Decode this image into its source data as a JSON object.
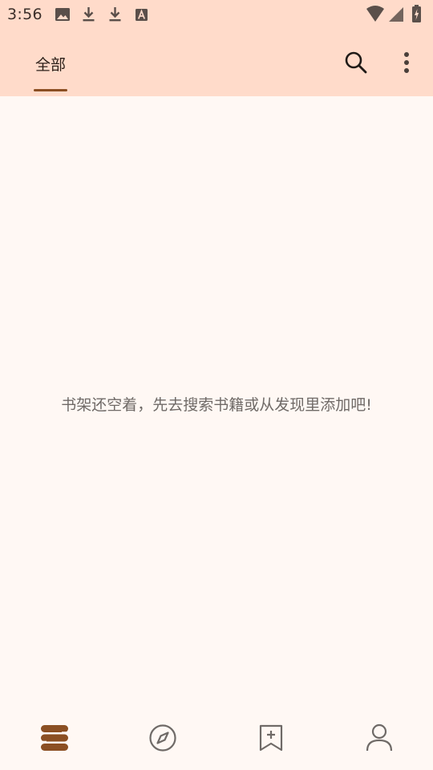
{
  "status_bar": {
    "time": "3:56",
    "notification_icons": [
      "image-icon",
      "download-icon",
      "download-icon",
      "font-icon"
    ],
    "system_icons": [
      "wifi-icon",
      "cell-signal-icon",
      "battery-charging-icon"
    ]
  },
  "app_bar": {
    "tabs": [
      {
        "label": "全部",
        "selected": true
      }
    ],
    "actions": [
      "search-icon",
      "more-vert-icon"
    ]
  },
  "empty_state": {
    "message": "书架还空着，先去搜索书籍或从发现里添加吧!"
  },
  "bottom_nav": {
    "items": [
      {
        "icon": "bookshelf-icon",
        "selected": true
      },
      {
        "icon": "compass-icon",
        "selected": false
      },
      {
        "icon": "bookmark-add-icon",
        "selected": false
      },
      {
        "icon": "person-icon",
        "selected": false
      }
    ]
  },
  "colors": {
    "app_bar_bg": "#FFDBCA",
    "page_bg": "#FFF8F4",
    "accent": "#8B4F23",
    "icon_gray": "#6f6a67",
    "text_dark": "#2b1f19"
  }
}
